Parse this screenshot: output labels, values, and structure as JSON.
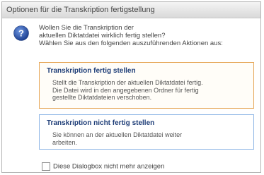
{
  "window": {
    "title": "Optionen für die Transkription fertigstellung"
  },
  "dialog": {
    "icon": "question-icon",
    "message_lines": [
      "Wollen Sie die Transkription der",
      "aktuellen Diktatdatei wirklich fertig stellen?",
      "Wählen Sie aus den folgenden auszuführenden Aktionen aus:"
    ],
    "options": [
      {
        "title": "Transkription fertig stellen",
        "description_lines": [
          "Stellt die Transkription der aktuellen Diktatdatei fertig.",
          "Die Datei wird in den angegebenen Ordner für fertig",
          "gestellte Diktatdateien verschoben."
        ]
      },
      {
        "title": "Transkription nicht fertig stellen",
        "description_lines": [
          "Sie können an der aktuellen Diktatdatei weiter",
          "arbeiten."
        ]
      }
    ],
    "checkbox_label": "Diese Dialogbox nicht mehr anzeigen"
  },
  "colors": {
    "selected_border": "#e6a85a",
    "option_title": "#1f3e78",
    "icon_blue": "#2b59b4"
  }
}
